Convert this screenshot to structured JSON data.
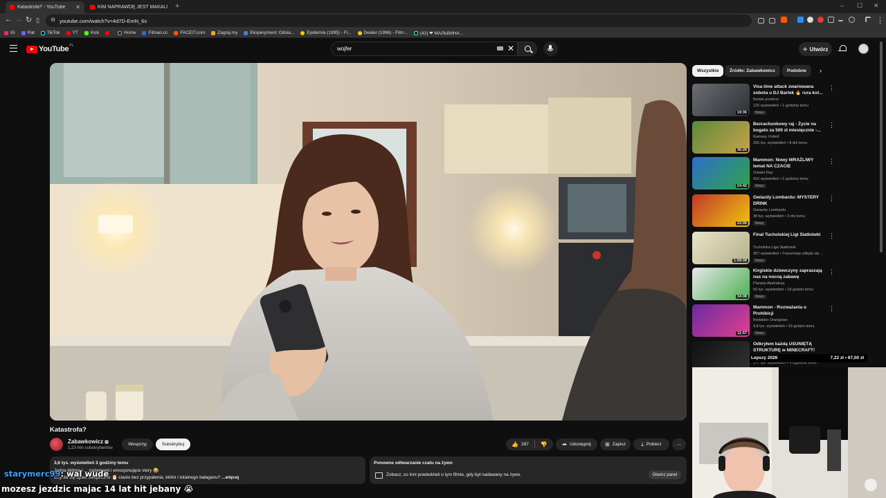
{
  "browser": {
    "tabs": [
      {
        "title": "Katastrofa? - YouTube",
        "active": true
      },
      {
        "title": "KIM NAPRAWDĘ JEST MAKALIERT",
        "active": false
      }
    ],
    "url": "youtube.com/watch?v=4d7D-EmN_6s",
    "bookmarks": [
      "IG",
      "Rat",
      "TikTok",
      "YT",
      "Kick",
      "",
      "Home",
      "Filman.cc",
      "FACEIT.com",
      "Zagraj.my",
      "Eksperyment: Odsia...",
      "Epidemia (1995) - Fi...",
      "Dealer (1996) - Film...",
      "(42) ❤ МАЛЬВИНА..."
    ],
    "bookmark_colors": [
      "#e1306c",
      "#7b5cff",
      "#111",
      "#ff0000",
      "#53fc18",
      "#ff0000",
      "#222",
      "#2a6cd6",
      "#ff5500",
      "#f5a623",
      "#4a7bd0",
      "#f5c518",
      "#f5c518",
      "#111"
    ]
  },
  "header": {
    "logo": "YouTube",
    "country": "PL",
    "search_value": "wojfer",
    "create_label": "Utwórz"
  },
  "video": {
    "title": "Katastrofa?",
    "channel": "Zabawkowicz",
    "subscribers": "1,23 mln subskrybentów",
    "join_label": "Wesprzyj",
    "subscribe_label": "Subskrybuj",
    "likes": "287",
    "share_label": "Udostępnij",
    "save_label": "Zapisz",
    "download_label": "Pobierz"
  },
  "description": {
    "stats": "3,6 tys. wyświetleń  3 godziny temu",
    "line1": "Jedna kłótnia i ... nażeniami i emocjonujące stery 😂",
    "line2": "Czy da się upiec świąteczne 🎅 ciasto bez przypalenia, kłótni i totalnego bałaganu?",
    "more": "...więcej"
  },
  "replay": {
    "heading": "Ponowne odtwarzanie czatu na żywo",
    "text": "Zobacz, co inni powiedzieli o tym filmie, gdy był nadawany na żywo.",
    "button": "Otwórz panel"
  },
  "stream_chat": {
    "user": "starymerc99",
    "msg1": ": wal wude",
    "msg2": "mozesz jezdzic majac 14 lat hit jebany 😭"
  },
  "sidebar": {
    "chips": [
      "Wszystkie",
      "Źródło: Zabawkowicz",
      "Podobne"
    ],
    "recs": [
      {
        "title": "Vixa time attack zwariowana sobota u DJ Bartek 🔥 rura kot...",
        "channel": "Bartek pozdroo",
        "meta": "120 wyświetleń • 1 godzinę temu",
        "badge": "Nowy",
        "duration": "19:35",
        "c1": "#6b6f73",
        "c2": "#2c2f33"
      },
      {
        "title": "Bezrachunkowy raj - Życie na bogato za 500 zł miesięcznie -...",
        "channel": "Ramsey United",
        "meta": "205 tys. wyświetleń • 8 dni temu",
        "badge": "",
        "duration": "36:26",
        "c1": "#5c8a3c",
        "c2": "#c9a24a"
      },
      {
        "title": "Mammon: Nowy WRAŻLIWY temat NA CZACIE",
        "channel": "Ostatni Raz",
        "meta": "916 wyświetleń • 2 godziny temu",
        "badge": "Nowy",
        "duration": "24:42",
        "c1": "#2f6fc8",
        "c2": "#2da34a"
      },
      {
        "title": "Gwiazdy Lombardu: MYSTERY DRINK",
        "channel": "Gwiazdy Lombardu",
        "meta": "38 tys. wyświetleń • 3 dni temu",
        "badge": "Nowy",
        "duration": "22:06",
        "c1": "#c0392b",
        "c2": "#f1c40f"
      },
      {
        "title": "Final Tucholskiej Ligi Siatkówki",
        "channel": "Tucholska Liga Siatkówki",
        "meta": "357 wyświetleń • Transmisja odbyła się ...",
        "badge": "Nowy",
        "duration": "1:58:08",
        "c1": "#e8e4c9",
        "c2": "#b5b08a"
      },
      {
        "title": "Kirgiskie dziewczyny zapraszają nas na nocną zabawę",
        "channel": "Planeta Abstrakcja",
        "meta": "50 tys. wyświetleń • 18 godzin temu",
        "badge": "Nowy",
        "duration": "34:08",
        "c1": "#e5e8ea",
        "c2": "#4caf50"
      },
      {
        "title": "Mammon - Rozważania o Prohibicji",
        "channel": "Redaktor Orangutan",
        "meta": "4,8 tys. wyświetleń • 19 godzin temu",
        "badge": "Nowy",
        "duration": "11:57",
        "c1": "#6a2ca0",
        "c2": "#e04090"
      },
      {
        "title": "Odkryłem każdą USUNIĘTĄ STRUKTURĘ w MINECRAFT!",
        "channel": "",
        "meta": "177 tys. wyświetleń • 4 tygodnie temu",
        "badge": "",
        "duration": "",
        "c1": "#111",
        "c2": "#333"
      }
    ]
  },
  "overlay": {
    "left": "Lepszy 2026",
    "right": "7,22 zł • 67,00 zł"
  }
}
